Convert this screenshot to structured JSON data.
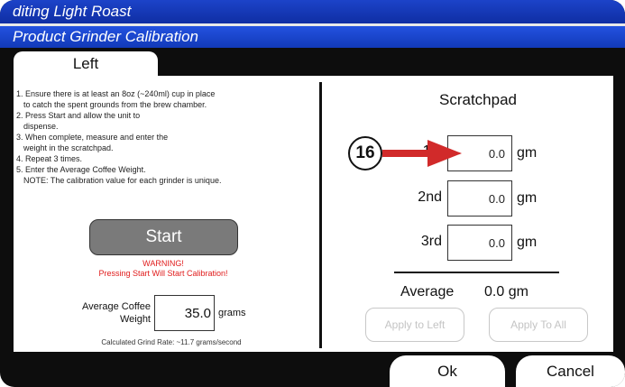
{
  "window": {
    "title": "diting Light Roast",
    "subtitle": "Product Grinder Calibration"
  },
  "tab": {
    "label": "Left"
  },
  "instructions": [
    "1. Ensure there is at least an 8oz (~240ml) cup in place",
    "    to catch the spent grounds from the brew chamber.",
    "2. Press Start and allow the unit to",
    "    dispense.",
    "3. When complete, measure and enter the",
    "    weight in the scratchpad.",
    "4. Repeat 3 times.",
    "5. Enter the Average Coffee Weight.",
    "    NOTE:  The calibration value for each grinder is unique."
  ],
  "start_button": {
    "label": "Start"
  },
  "warning": {
    "title": "WARNING!",
    "text": "Pressing Start Will Start Calibration!"
  },
  "average_weight": {
    "label_line1": "Average Coffee",
    "label_line2": "Weight",
    "value": "35.0",
    "unit": "grams"
  },
  "grind_rate": {
    "text": "Calculated Grind Rate: ~11.7 grams/second"
  },
  "scratchpad": {
    "title": "Scratchpad",
    "rows": [
      {
        "label": "1st",
        "value": "0.0",
        "unit": "gm"
      },
      {
        "label": "2nd",
        "value": "0.0",
        "unit": "gm"
      },
      {
        "label": "3rd",
        "value": "0.0",
        "unit": "gm"
      }
    ],
    "average_label": "Average",
    "average_value": "0.0 gm",
    "apply_left": "Apply to Left",
    "apply_all": "Apply To All"
  },
  "footer": {
    "ok": "Ok",
    "cancel": "Cancel"
  },
  "annotation": {
    "number": "16",
    "color": "#d12a2a"
  },
  "colors": {
    "title_bar": "#1c43c9",
    "warning": "#e01b1b",
    "start_button": "#7a7a7a"
  }
}
